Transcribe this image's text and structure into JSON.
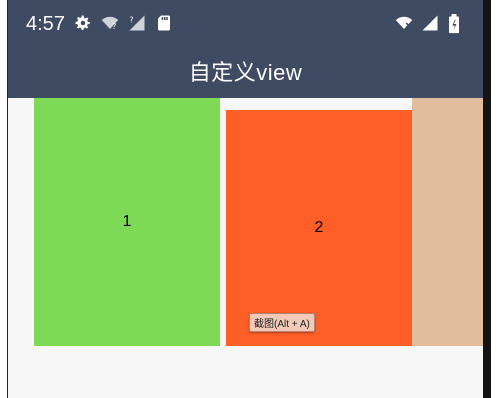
{
  "status_bar": {
    "time": "4:57",
    "icons_left": [
      "gear-icon",
      "wifi-question-icon",
      "signal-question-icon",
      "sd-card-icon"
    ],
    "icons_right": [
      "wifi-off-icon",
      "signal-icon",
      "battery-icon"
    ]
  },
  "app_bar": {
    "title": "自定义view"
  },
  "colors": {
    "bar": "#3f4a63",
    "panel_1": "#7ed957",
    "panel_2": "#ff5f26",
    "panel_3": "#dfbd9d"
  },
  "panels": [
    {
      "label": "1"
    },
    {
      "label": "2"
    },
    {
      "label": ""
    }
  ],
  "tooltip": {
    "text": "截图(Alt + A)"
  }
}
